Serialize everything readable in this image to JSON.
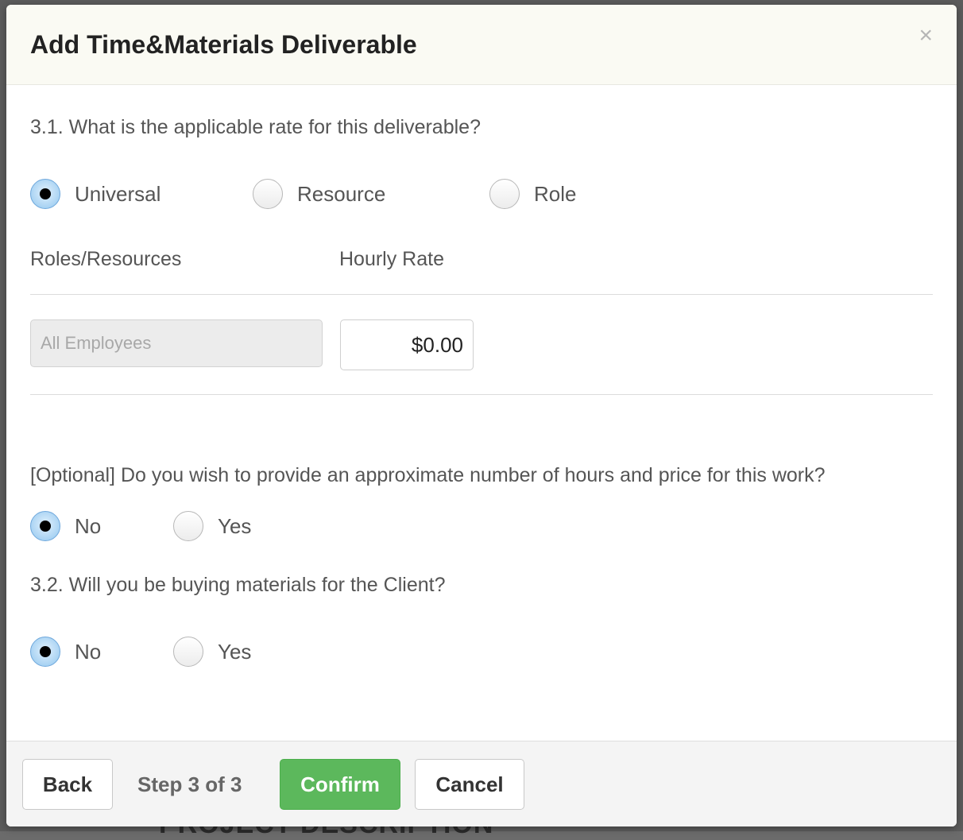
{
  "background": {
    "partial_text": "PROJECT DESCRIPTION"
  },
  "modal": {
    "title": "Add Time&Materials Deliverable",
    "close_glyph": "×"
  },
  "rate_question": {
    "text": "3.1. What is the applicable rate for this deliverable?",
    "options": [
      {
        "label": "Universal",
        "checked": true
      },
      {
        "label": "Resource",
        "checked": false
      },
      {
        "label": "Role",
        "checked": false
      }
    ]
  },
  "rate_table": {
    "col_roles": "Roles/Resources",
    "col_rate": "Hourly Rate",
    "row": {
      "role_placeholder": "All Employees",
      "rate_value": "$0.00"
    }
  },
  "optional_question": {
    "text": "[Optional] Do you wish to provide an approximate number of hours and price for this work?",
    "options": [
      {
        "label": "No",
        "checked": true
      },
      {
        "label": "Yes",
        "checked": false
      }
    ]
  },
  "materials_question": {
    "text": "3.2. Will you be buying materials for the Client?",
    "options": [
      {
        "label": "No",
        "checked": true
      },
      {
        "label": "Yes",
        "checked": false
      }
    ]
  },
  "footer": {
    "back_label": "Back",
    "step_text": "Step 3 of 3",
    "confirm_label": "Confirm",
    "cancel_label": "Cancel"
  },
  "colors": {
    "confirm_green": "#5cb85c",
    "radio_checked_blue": "#a9d3f3",
    "header_bg": "#fafaf3"
  }
}
